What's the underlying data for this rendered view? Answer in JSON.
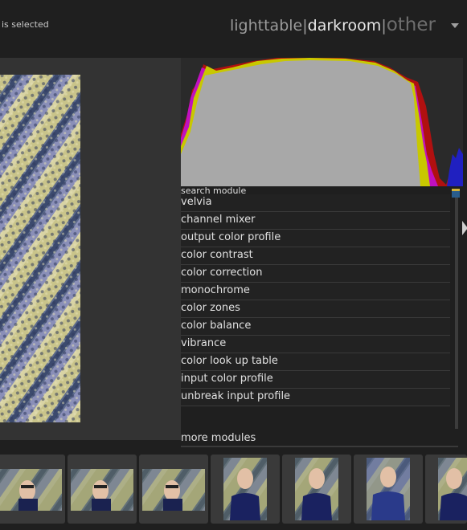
{
  "header": {
    "selection_text": "is selected",
    "views": [
      "lighttable",
      "darkroom",
      "other"
    ],
    "separator": "|",
    "active_view": "darkroom"
  },
  "right_panel": {
    "search_label": "search module",
    "modules": [
      "velvia",
      "channel mixer",
      "output color profile",
      "color contrast",
      "color correction",
      "monochrome",
      "color zones",
      "color balance",
      "vibrance",
      "color look up table",
      "input color profile",
      "unbreak input profile"
    ],
    "more_modules": "more modules"
  },
  "colors": {
    "background": "#1f1f1f",
    "center_view": "#333333",
    "text": "#e0e0e0",
    "histogram_fill": "#a8a8a8"
  },
  "icons": [
    "dropdown-arrow-icon",
    "search-clear-icon",
    "panel-expand-arrow-icon"
  ]
}
